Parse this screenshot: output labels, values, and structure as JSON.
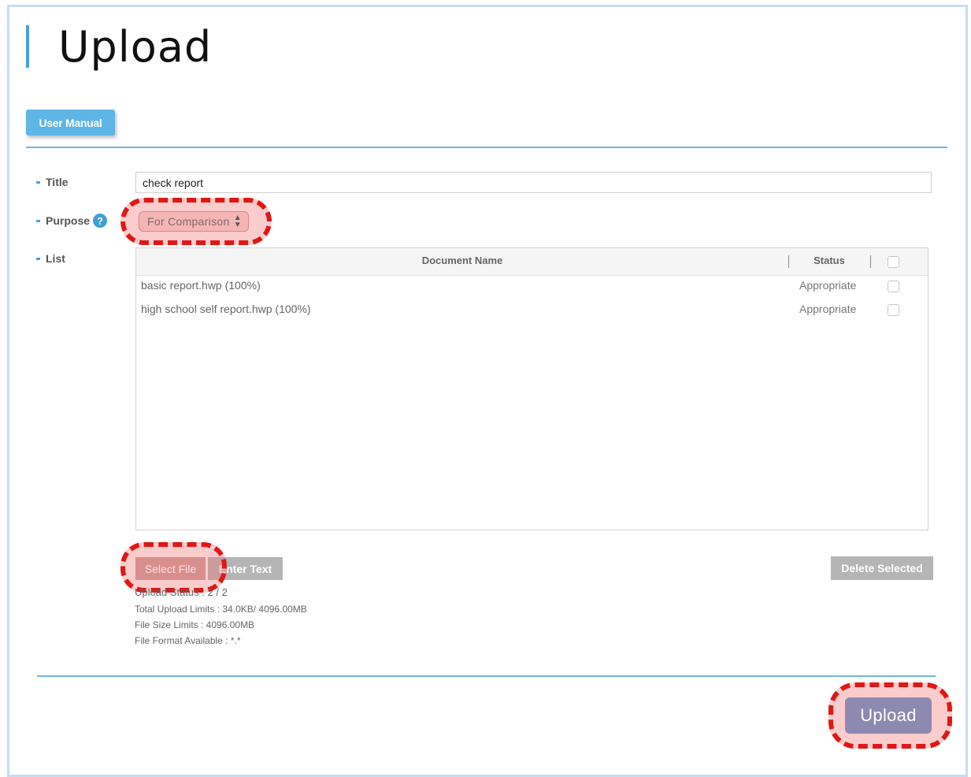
{
  "page": {
    "title": "Upload"
  },
  "toolbar": {
    "user_manual_label": "User Manual"
  },
  "form": {
    "title_label": "Title",
    "title_value": "check report",
    "purpose_label": "Purpose",
    "purpose_selected": "For Comparison",
    "list_label": "List"
  },
  "list": {
    "columns": {
      "document_name": "Document Name",
      "status": "Status"
    },
    "rows": [
      {
        "name": "basic report.hwp (100%)",
        "status": "Appropriate"
      },
      {
        "name": "high school self report.hwp (100%)",
        "status": "Appropriate"
      }
    ]
  },
  "actions": {
    "select_file": "Select File",
    "enter_text": "Enter Text",
    "delete_selected": "Delete Selected",
    "upload": "Upload"
  },
  "info": {
    "upload_status": "Upload Status : 2 / 2",
    "total_limits": "Total Upload Limits : 34.0KB/ 4096.00MB",
    "file_size_limits": "File Size Limits : 4096.00MB",
    "file_format": "File Format Available : *.*"
  },
  "colors": {
    "accent": "#4a9fd8",
    "highlight_ring": "#e01717",
    "upload_button": "#8d89b0"
  }
}
